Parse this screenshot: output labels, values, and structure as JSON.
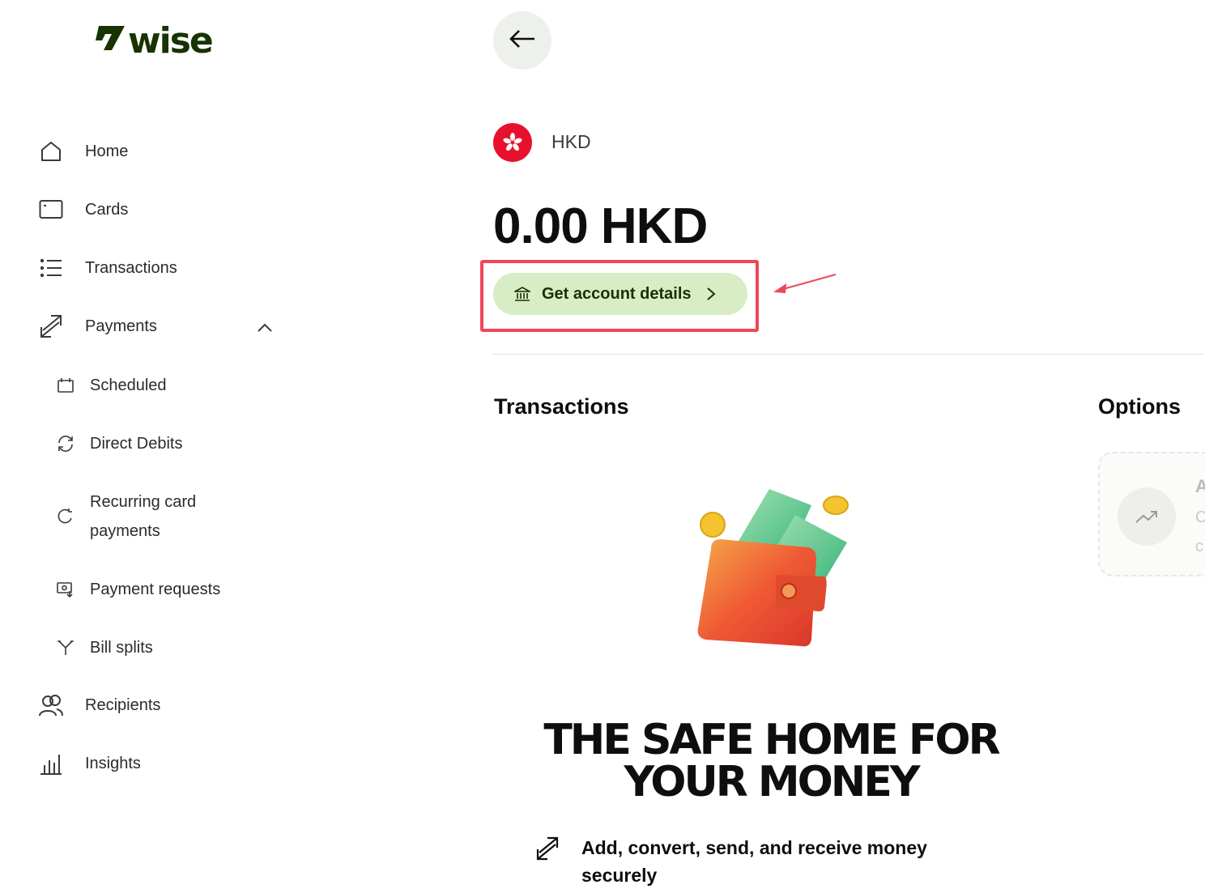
{
  "brand": {
    "logo_text": "wise"
  },
  "sidebar": {
    "items": [
      {
        "label": "Home",
        "icon": "home-icon"
      },
      {
        "label": "Cards",
        "icon": "card-icon"
      },
      {
        "label": "Transactions",
        "icon": "list-icon"
      },
      {
        "label": "Payments",
        "icon": "payments-icon",
        "expanded": true
      }
    ],
    "payments_sub": [
      {
        "label": "Scheduled",
        "icon": "calendar-icon"
      },
      {
        "label": "Direct Debits",
        "icon": "refresh-icon"
      },
      {
        "label": "Recurring card payments",
        "icon": "repeat-icon"
      },
      {
        "label": "Payment requests",
        "icon": "request-icon"
      },
      {
        "label": "Bill splits",
        "icon": "split-icon"
      }
    ],
    "bottom_items": [
      {
        "label": "Recipients",
        "icon": "recipients-icon"
      },
      {
        "label": "Insights",
        "icon": "bar-chart-icon"
      }
    ]
  },
  "account": {
    "currency_code": "HKD",
    "balance": "0.00 HKD",
    "details_button": "Get account details"
  },
  "sections": {
    "transactions_title": "Transactions",
    "options_title": "Options",
    "option_card": {
      "title": "A",
      "line1": "C",
      "line2": "c"
    }
  },
  "promo": {
    "headline_line1": "THE SAFE HOME FOR",
    "headline_line2": "YOUR MONEY",
    "feature_text": "Add, convert, send, and receive money securely"
  },
  "colors": {
    "brand_green": "#163300",
    "button_green_bg": "#d8ecc6",
    "highlight_red": "#f0475b",
    "flag_red": "#e8112d"
  }
}
